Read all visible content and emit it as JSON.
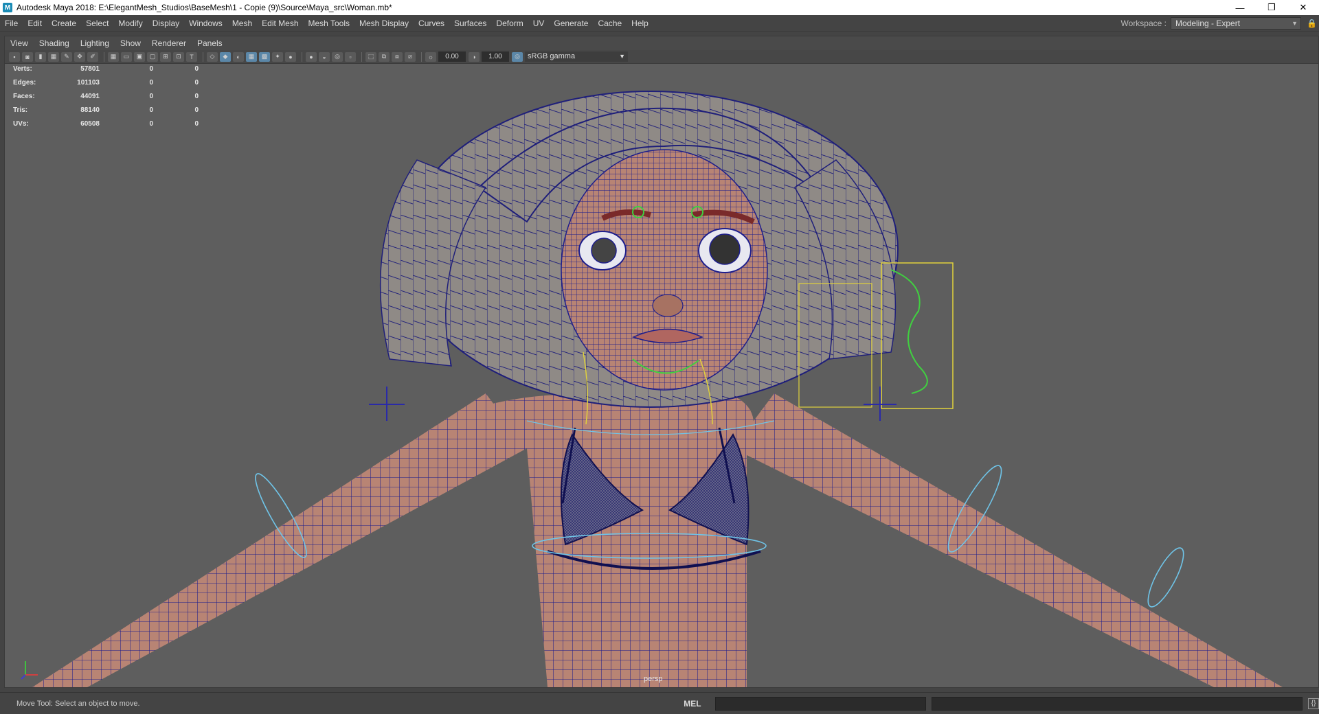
{
  "titlebar": {
    "title": "Autodesk Maya 2018: E:\\ElegantMesh_Studios\\BaseMesh\\1 - Copie (9)\\Source\\Maya_src\\Woman.mb*",
    "minimize": "—",
    "restore": "❐",
    "close": "✕"
  },
  "menu": [
    "File",
    "Edit",
    "Create",
    "Select",
    "Modify",
    "Display",
    "Windows",
    "Mesh",
    "Edit Mesh",
    "Mesh Tools",
    "Mesh Display",
    "Curves",
    "Surfaces",
    "Deform",
    "UV",
    "Generate",
    "Cache",
    "Help"
  ],
  "workspace": {
    "label": "Workspace :",
    "value": "Modeling - Expert"
  },
  "panel_menu": [
    "View",
    "Shading",
    "Lighting",
    "Show",
    "Renderer",
    "Panels"
  ],
  "panel_toolbar": {
    "exposure": "0.00",
    "gamma": "1.00",
    "color_space": "sRGB gamma"
  },
  "hud": {
    "rows": [
      {
        "label": "Verts:",
        "value": "57801",
        "sel": "0",
        "comp": "0"
      },
      {
        "label": "Edges:",
        "value": "101103",
        "sel": "0",
        "comp": "0"
      },
      {
        "label": "Faces:",
        "value": "44091",
        "sel": "0",
        "comp": "0"
      },
      {
        "label": "Tris:",
        "value": "88140",
        "sel": "0",
        "comp": "0"
      },
      {
        "label": "UVs:",
        "value": "60508",
        "sel": "0",
        "comp": "0"
      }
    ]
  },
  "viewport": {
    "camera": "persp"
  },
  "status": {
    "help": "Move Tool: Select an object to move.",
    "mel": "MEL"
  },
  "colors": {
    "wire": "#1e1e8c",
    "skin": "#b88474",
    "hair": "#8f8a86",
    "selection": "#e0d23c",
    "controls": "#6fc4e8"
  }
}
